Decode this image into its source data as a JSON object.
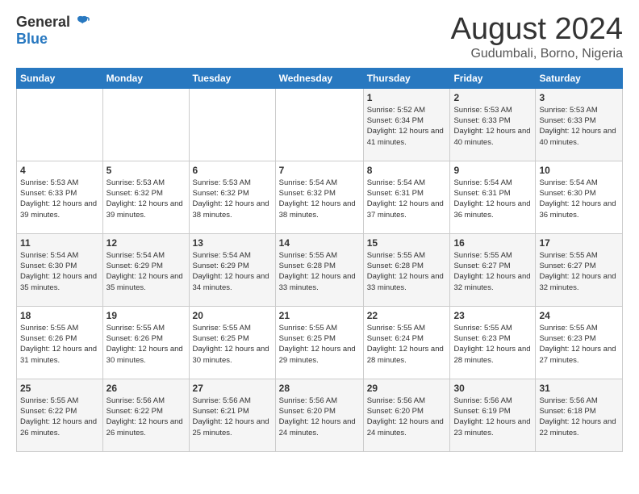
{
  "logo": {
    "general": "General",
    "blue": "Blue"
  },
  "title": "August 2024",
  "location": "Gudumbali, Borno, Nigeria",
  "days_of_week": [
    "Sunday",
    "Monday",
    "Tuesday",
    "Wednesday",
    "Thursday",
    "Friday",
    "Saturday"
  ],
  "weeks": [
    [
      {
        "day": "",
        "info": ""
      },
      {
        "day": "",
        "info": ""
      },
      {
        "day": "",
        "info": ""
      },
      {
        "day": "",
        "info": ""
      },
      {
        "day": "1",
        "info": "Sunrise: 5:52 AM\nSunset: 6:34 PM\nDaylight: 12 hours\nand 41 minutes."
      },
      {
        "day": "2",
        "info": "Sunrise: 5:53 AM\nSunset: 6:33 PM\nDaylight: 12 hours\nand 40 minutes."
      },
      {
        "day": "3",
        "info": "Sunrise: 5:53 AM\nSunset: 6:33 PM\nDaylight: 12 hours\nand 40 minutes."
      }
    ],
    [
      {
        "day": "4",
        "info": "Sunrise: 5:53 AM\nSunset: 6:33 PM\nDaylight: 12 hours\nand 39 minutes."
      },
      {
        "day": "5",
        "info": "Sunrise: 5:53 AM\nSunset: 6:32 PM\nDaylight: 12 hours\nand 39 minutes."
      },
      {
        "day": "6",
        "info": "Sunrise: 5:53 AM\nSunset: 6:32 PM\nDaylight: 12 hours\nand 38 minutes."
      },
      {
        "day": "7",
        "info": "Sunrise: 5:54 AM\nSunset: 6:32 PM\nDaylight: 12 hours\nand 38 minutes."
      },
      {
        "day": "8",
        "info": "Sunrise: 5:54 AM\nSunset: 6:31 PM\nDaylight: 12 hours\nand 37 minutes."
      },
      {
        "day": "9",
        "info": "Sunrise: 5:54 AM\nSunset: 6:31 PM\nDaylight: 12 hours\nand 36 minutes."
      },
      {
        "day": "10",
        "info": "Sunrise: 5:54 AM\nSunset: 6:30 PM\nDaylight: 12 hours\nand 36 minutes."
      }
    ],
    [
      {
        "day": "11",
        "info": "Sunrise: 5:54 AM\nSunset: 6:30 PM\nDaylight: 12 hours\nand 35 minutes."
      },
      {
        "day": "12",
        "info": "Sunrise: 5:54 AM\nSunset: 6:29 PM\nDaylight: 12 hours\nand 35 minutes."
      },
      {
        "day": "13",
        "info": "Sunrise: 5:54 AM\nSunset: 6:29 PM\nDaylight: 12 hours\nand 34 minutes."
      },
      {
        "day": "14",
        "info": "Sunrise: 5:55 AM\nSunset: 6:28 PM\nDaylight: 12 hours\nand 33 minutes."
      },
      {
        "day": "15",
        "info": "Sunrise: 5:55 AM\nSunset: 6:28 PM\nDaylight: 12 hours\nand 33 minutes."
      },
      {
        "day": "16",
        "info": "Sunrise: 5:55 AM\nSunset: 6:27 PM\nDaylight: 12 hours\nand 32 minutes."
      },
      {
        "day": "17",
        "info": "Sunrise: 5:55 AM\nSunset: 6:27 PM\nDaylight: 12 hours\nand 32 minutes."
      }
    ],
    [
      {
        "day": "18",
        "info": "Sunrise: 5:55 AM\nSunset: 6:26 PM\nDaylight: 12 hours\nand 31 minutes."
      },
      {
        "day": "19",
        "info": "Sunrise: 5:55 AM\nSunset: 6:26 PM\nDaylight: 12 hours\nand 30 minutes."
      },
      {
        "day": "20",
        "info": "Sunrise: 5:55 AM\nSunset: 6:25 PM\nDaylight: 12 hours\nand 30 minutes."
      },
      {
        "day": "21",
        "info": "Sunrise: 5:55 AM\nSunset: 6:25 PM\nDaylight: 12 hours\nand 29 minutes."
      },
      {
        "day": "22",
        "info": "Sunrise: 5:55 AM\nSunset: 6:24 PM\nDaylight: 12 hours\nand 28 minutes."
      },
      {
        "day": "23",
        "info": "Sunrise: 5:55 AM\nSunset: 6:23 PM\nDaylight: 12 hours\nand 28 minutes."
      },
      {
        "day": "24",
        "info": "Sunrise: 5:55 AM\nSunset: 6:23 PM\nDaylight: 12 hours\nand 27 minutes."
      }
    ],
    [
      {
        "day": "25",
        "info": "Sunrise: 5:55 AM\nSunset: 6:22 PM\nDaylight: 12 hours\nand 26 minutes."
      },
      {
        "day": "26",
        "info": "Sunrise: 5:56 AM\nSunset: 6:22 PM\nDaylight: 12 hours\nand 26 minutes."
      },
      {
        "day": "27",
        "info": "Sunrise: 5:56 AM\nSunset: 6:21 PM\nDaylight: 12 hours\nand 25 minutes."
      },
      {
        "day": "28",
        "info": "Sunrise: 5:56 AM\nSunset: 6:20 PM\nDaylight: 12 hours\nand 24 minutes."
      },
      {
        "day": "29",
        "info": "Sunrise: 5:56 AM\nSunset: 6:20 PM\nDaylight: 12 hours\nand 24 minutes."
      },
      {
        "day": "30",
        "info": "Sunrise: 5:56 AM\nSunset: 6:19 PM\nDaylight: 12 hours\nand 23 minutes."
      },
      {
        "day": "31",
        "info": "Sunrise: 5:56 AM\nSunset: 6:18 PM\nDaylight: 12 hours\nand 22 minutes."
      }
    ]
  ]
}
